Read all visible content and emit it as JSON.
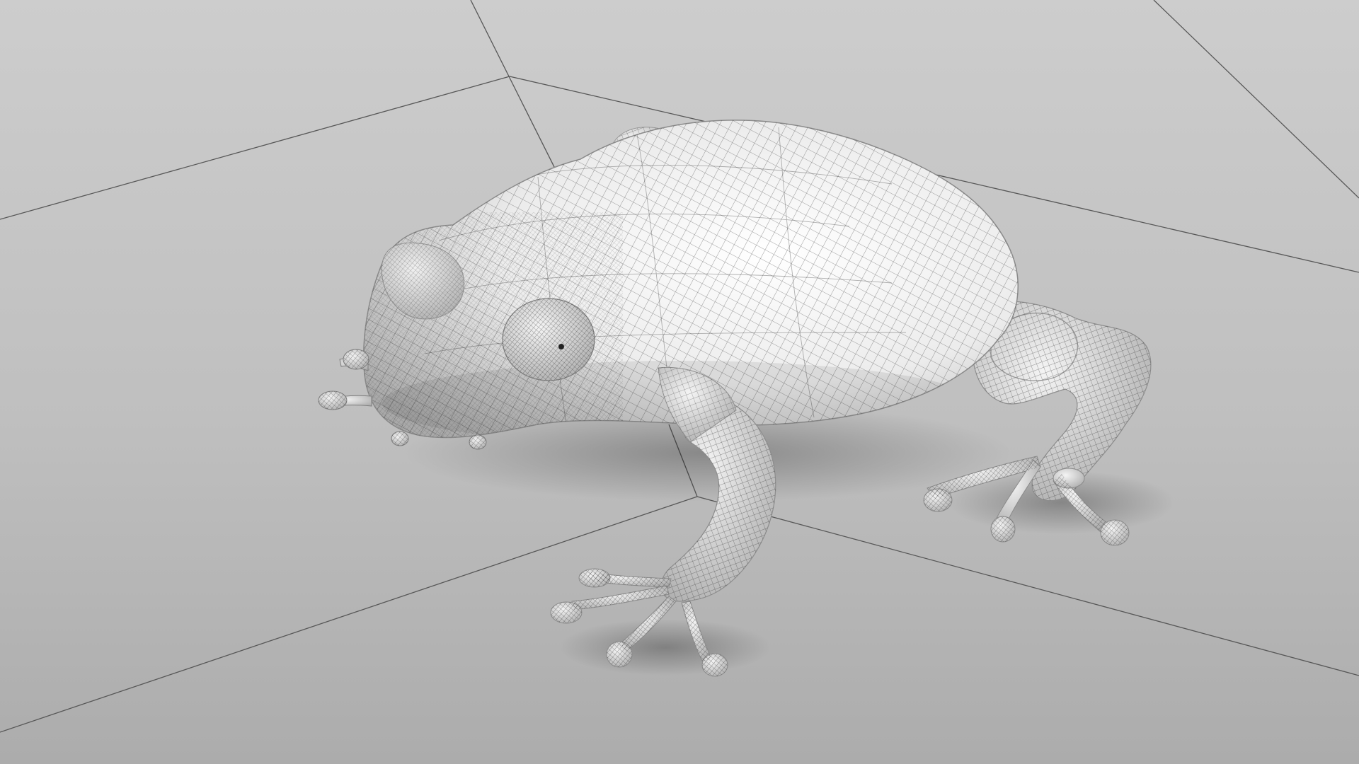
{
  "scene": {
    "subject": "frog-wireframe-render",
    "colors": {
      "background_light": "#cfcfcf",
      "background_dark": "#adadad",
      "floor_line": "#555555",
      "body_light": "#fafafa",
      "body_shadow": "#bdbdbd",
      "mesh_line": "#222222"
    }
  }
}
